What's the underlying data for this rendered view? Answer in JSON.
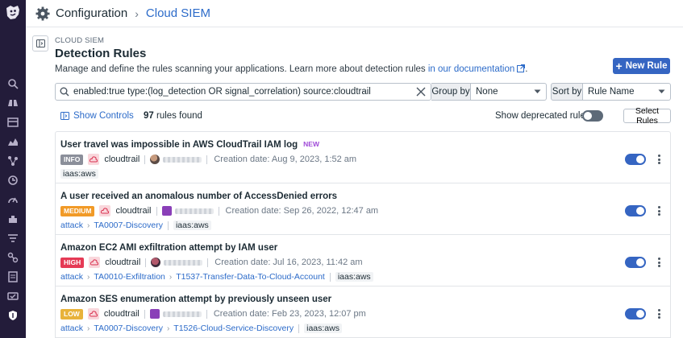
{
  "breadcrumb": {
    "root": "Configuration",
    "current": "Cloud SIEM"
  },
  "page": {
    "overline": "CLOUD SIEM",
    "title": "Detection Rules",
    "description": "Manage and define the rules scanning your applications. Learn more about detection rules ",
    "doc_link": "in our documentation",
    "new_rule_label": "New Rule"
  },
  "search": {
    "query": "enabled:true type:(log_detection OR signal_correlation) source:cloudtrail"
  },
  "group_by": {
    "label": "Group by",
    "value": "None"
  },
  "sort_by": {
    "label": "Sort by",
    "value": "Rule Name"
  },
  "controls": {
    "show_controls": "Show Controls",
    "rules_count": "97",
    "rules_found": "rules found",
    "show_deprecated": "Show deprecated rules",
    "select_rules": "Select Rules"
  },
  "rules": [
    {
      "title": "User travel was impossible in AWS CloudTrail IAM log",
      "badge": "NEW",
      "severity": "INFO",
      "source": "cloudtrail",
      "created": "Creation date: Aug 9, 2023, 1:52 am",
      "tactics": [],
      "tag": "iaas:aws",
      "enabled": true
    },
    {
      "title": "A user received an anomalous number of AccessDenied errors",
      "badge": "",
      "severity": "MEDIUM",
      "source": "cloudtrail",
      "created": "Creation date: Sep 26, 2022, 12:47 am",
      "tactics": [
        "attack",
        "TA0007-Discovery"
      ],
      "tag": "iaas:aws",
      "enabled": true
    },
    {
      "title": "Amazon EC2 AMI exfiltration attempt by IAM user",
      "badge": "",
      "severity": "HIGH",
      "source": "cloudtrail",
      "created": "Creation date: Jul 16, 2023, 11:42 am",
      "tactics": [
        "attack",
        "TA0010-Exfiltration",
        "T1537-Transfer-Data-To-Cloud-Account"
      ],
      "tag": "iaas:aws",
      "enabled": true
    },
    {
      "title": "Amazon SES enumeration attempt by previously unseen user",
      "badge": "",
      "severity": "LOW",
      "source": "cloudtrail",
      "created": "Creation date: Feb 23, 2023, 12:07 pm",
      "tactics": [
        "attack",
        "TA0007-Discovery",
        "T1526-Cloud-Service-Discovery"
      ],
      "tag": "iaas:aws",
      "enabled": true
    }
  ],
  "colors": {
    "nav_bg": "#231c3a",
    "accent": "#3565c2",
    "link": "#2c6bc9",
    "sev_info": "#8b8f9a",
    "sev_medium": "#f19a27",
    "sev_high": "#e53a55",
    "sev_low": "#e8b23a"
  },
  "nav_icons": [
    "datadog-logo",
    "search-icon",
    "binoculars-icon",
    "dashboard-icon",
    "infrastructure-icon",
    "apm-icon",
    "security-icon",
    "monitors-icon",
    "integrations-icon",
    "logs-icon",
    "network-icon",
    "notebook-icon",
    "synthetics-icon",
    "shield-icon"
  ]
}
